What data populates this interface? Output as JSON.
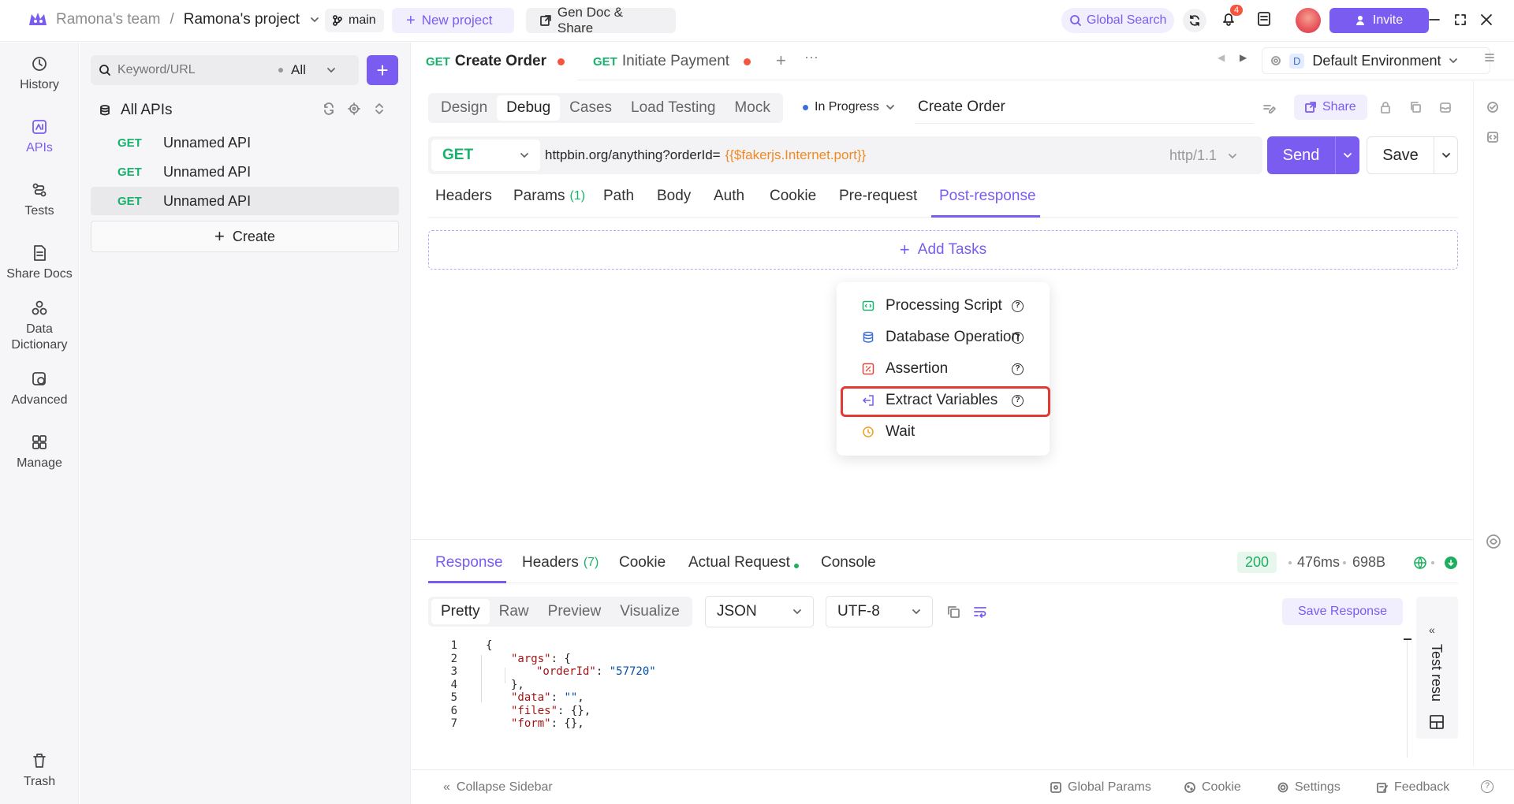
{
  "topbar": {
    "team": "Ramona's team",
    "separator": "/",
    "project": "Ramona's project",
    "branch": "main",
    "new_project": "New project",
    "gen_doc": "Gen Doc & Share",
    "global_search": "Global Search",
    "notif_count": "4",
    "invite": "Invite"
  },
  "rail": {
    "items": [
      {
        "label": "History",
        "icon": "history-icon"
      },
      {
        "label": "APIs",
        "icon": "apis-icon"
      },
      {
        "label": "Tests",
        "icon": "tests-icon"
      },
      {
        "label": "Share Docs",
        "icon": "share-docs-icon"
      },
      {
        "label": "Data Dictionary",
        "icon": "data-dictionary-icon"
      },
      {
        "label": "Advanced",
        "icon": "advanced-icon"
      },
      {
        "label": "Manage",
        "icon": "manage-icon"
      }
    ],
    "trash": "Trash"
  },
  "sidebar": {
    "search_placeholder": "Keyword/URL",
    "filter": "All",
    "tree_root": "All APIs",
    "apis": [
      {
        "method": "GET",
        "name": "Unnamed API"
      },
      {
        "method": "GET",
        "name": "Unnamed API"
      },
      {
        "method": "GET",
        "name": "Unnamed API"
      }
    ],
    "create": "Create"
  },
  "tabs": [
    {
      "method": "GET",
      "name": "Create Order"
    },
    {
      "method": "GET",
      "name": "Initiate Payment"
    }
  ],
  "environment": {
    "badge": "D",
    "name": "Default Environment"
  },
  "mode_tabs": [
    "Design",
    "Debug",
    "Cases",
    "Load Testing",
    "Mock"
  ],
  "status": "In Progress",
  "api_name": "Create Order",
  "share": "Share",
  "request": {
    "method": "GET",
    "url_prefix": "httpbin.org/anything?orderId=",
    "url_var": "{{$fakerjs.Internet.port}}",
    "protocol": "http/1.1",
    "send": "Send",
    "save": "Save"
  },
  "req_tabs": {
    "headers": "Headers",
    "params": "Params",
    "params_count": "(1)",
    "path": "Path",
    "body": "Body",
    "auth": "Auth",
    "cookie": "Cookie",
    "pre": "Pre-request",
    "post": "Post-response"
  },
  "add_tasks": "Add Tasks",
  "menu": {
    "items": [
      {
        "label": "Processing Script",
        "icon": "script-icon",
        "color": "#19b26c"
      },
      {
        "label": "Database Operation",
        "icon": "database-icon",
        "color": "#3b6fd9"
      },
      {
        "label": "Assertion",
        "icon": "assertion-icon",
        "color": "#e5483c"
      },
      {
        "label": "Extract Variables",
        "icon": "extract-icon",
        "color": "#7b5cf0"
      },
      {
        "label": "Wait",
        "icon": "wait-icon",
        "color": "#f0a020"
      }
    ],
    "highlight_color": "#e23a32"
  },
  "response": {
    "tabs": {
      "response": "Response",
      "headers": "Headers",
      "headers_count": "(7)",
      "cookie": "Cookie",
      "actual": "Actual Request",
      "console": "Console"
    },
    "status_code": "200",
    "time": "476ms",
    "size": "698B",
    "view_tabs": [
      "Pretty",
      "Raw",
      "Preview",
      "Visualize"
    ],
    "format": "JSON",
    "encoding": "UTF-8",
    "save_response": "Save Response",
    "side_panel": "Test resu",
    "code_lines": [
      {
        "n": "1",
        "indent": 0,
        "parts": [
          [
            "p",
            "{"
          ]
        ]
      },
      {
        "n": "2",
        "indent": 1,
        "parts": [
          [
            "k",
            "\"args\""
          ],
          [
            "p",
            ": {"
          ]
        ]
      },
      {
        "n": "3",
        "indent": 2,
        "parts": [
          [
            "k",
            "\"orderId\""
          ],
          [
            "p",
            ": "
          ],
          [
            "s",
            "\"57720\""
          ]
        ]
      },
      {
        "n": "4",
        "indent": 1,
        "parts": [
          [
            "p",
            "},"
          ]
        ]
      },
      {
        "n": "5",
        "indent": 1,
        "parts": [
          [
            "k",
            "\"data\""
          ],
          [
            "p",
            ": "
          ],
          [
            "s",
            "\"\""
          ],
          [
            "p",
            ","
          ]
        ]
      },
      {
        "n": "6",
        "indent": 1,
        "parts": [
          [
            "k",
            "\"files\""
          ],
          [
            "p",
            ": {},"
          ]
        ]
      },
      {
        "n": "7",
        "indent": 1,
        "parts": [
          [
            "k",
            "\"form\""
          ],
          [
            "p",
            ": {},"
          ]
        ]
      }
    ]
  },
  "bottombar": {
    "collapse": "Collapse Sidebar",
    "global_params": "Global Params",
    "cookie": "Cookie",
    "settings": "Settings",
    "feedback": "Feedback"
  },
  "colors": {
    "accent": "#7b5cf0",
    "get": "#19b26c",
    "var": "#f08a24",
    "success": "#1fae60"
  }
}
